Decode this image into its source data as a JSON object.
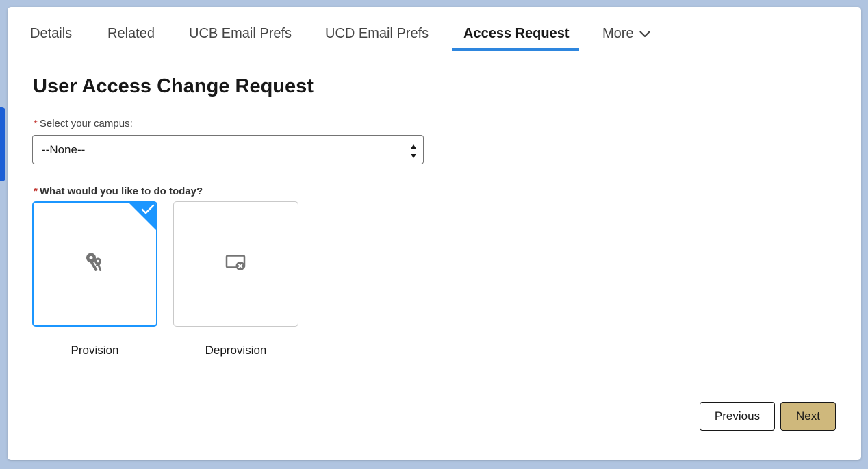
{
  "tabs": [
    {
      "label": "Details",
      "active": false
    },
    {
      "label": "Related",
      "active": false
    },
    {
      "label": "UCB Email Prefs",
      "active": false
    },
    {
      "label": "UCD Email Prefs",
      "active": false
    },
    {
      "label": "Access Request",
      "active": true
    },
    {
      "label": "More",
      "active": false
    }
  ],
  "form": {
    "title": "User Access Change Request",
    "required_marker": "*",
    "campus": {
      "label": "Select your campus:",
      "selected_value": "--None--"
    },
    "question": {
      "label": "What would you like to do today?",
      "options": [
        {
          "label": "Provision",
          "icon": "key-icon",
          "selected": true
        },
        {
          "label": "Deprovision",
          "icon": "screen-remove-icon",
          "selected": false
        }
      ]
    }
  },
  "footer": {
    "previous_label": "Previous",
    "next_label": "Next"
  },
  "colors": {
    "accent": "#1b96ff",
    "tab_underline": "#2e86de",
    "next_button": "#cfb87c",
    "required": "#c23934",
    "background": "#b0c4e0"
  }
}
